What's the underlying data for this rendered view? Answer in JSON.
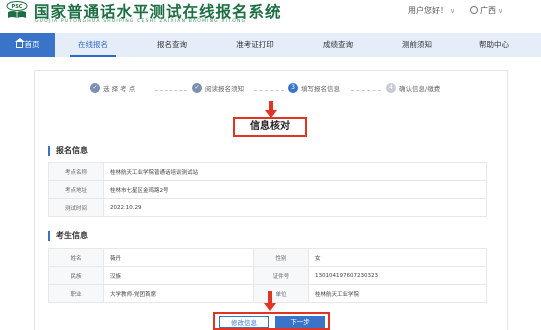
{
  "header": {
    "logo_text": "PSC",
    "brand_title": "国家普通话水平测试在线报名系统",
    "brand_pinyin": "GUOJIA PUTONGHUA SHUIPING CESHI ZAIXIAN BAOMING XITONG",
    "user_greeting": "用户您好！",
    "region": "广西"
  },
  "nav": {
    "home": "首页",
    "items": [
      "在线报名",
      "报名查询",
      "准考证打印",
      "成绩查询",
      "测前须知",
      "帮助中心"
    ],
    "active": "在线报名"
  },
  "steps": [
    {
      "num": "✓",
      "label": "选 择 考 点",
      "status": "done"
    },
    {
      "num": "✓",
      "label": "阅读报名须知",
      "status": "done"
    },
    {
      "num": "3",
      "label": "填写报名信息",
      "status": "current"
    },
    {
      "num": "4",
      "label": "确认信息/缴费",
      "status": "todo"
    }
  ],
  "page_title": "信息核对",
  "registration": {
    "heading": "报名信息",
    "rows": [
      {
        "key": "考点名称",
        "value": "桂林航天工业学院普通话培训测试站"
      },
      {
        "key": "考点地址",
        "value": "桂林市七星区金鸡路2号"
      },
      {
        "key": "测试时间",
        "value": "2022.10.29"
      }
    ]
  },
  "candidate": {
    "heading": "考生信息",
    "rows": [
      {
        "k1": "姓名",
        "v1": "薇丹",
        "k2": "性别",
        "v2": "女"
      },
      {
        "k1": "民族",
        "v1": "汉族",
        "k2": "证件号",
        "v2": "130104197607230323"
      },
      {
        "k1": "职业",
        "v1": "大学教师-党团首席",
        "k2": "单位",
        "v2": "桂林航天工业学院"
      }
    ]
  },
  "buttons": {
    "edit": "修改信息",
    "next": "下一步"
  },
  "colors": {
    "primary": "#3a74c8",
    "highlight": "#e03424",
    "brand_green": "#1d6f43",
    "nav_bg": "#e4edf8"
  }
}
